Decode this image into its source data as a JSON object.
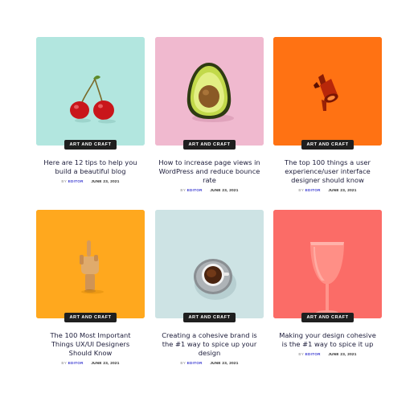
{
  "posts": [
    {
      "category": "ART AND CRAFT",
      "title": "Here are 12 tips to help you build a beautiful blog",
      "by": "BY",
      "author": "EDITOR",
      "date": "JUNE 23, 2021",
      "image_bg": "#b2e6df",
      "image_subject": "cherries"
    },
    {
      "category": "ART AND CRAFT",
      "title": "How to increase page views in WordPress and reduce bounce rate",
      "by": "BY",
      "author": "EDITOR",
      "date": "JUNE 23, 2021",
      "image_bg": "#f0b9cf",
      "image_subject": "avocado"
    },
    {
      "category": "ART AND CRAFT",
      "title": "The top 100 things a user experience/user interface designer should know",
      "by": "BY",
      "author": "EDITOR",
      "date": "JUNE 23, 2021",
      "image_bg": "#ff7213",
      "image_subject": "megaphone"
    },
    {
      "category": "ART AND CRAFT",
      "title": "The 100 Most Important Things UX/UI Designers Should Know",
      "by": "BY",
      "author": "EDITOR",
      "date": "JUNE 23, 2021",
      "image_bg": "#ffa81e",
      "image_subject": "wooden-hand"
    },
    {
      "category": "ART AND CRAFT",
      "title": "Creating a cohesive brand is the #1 way to spice up your design",
      "by": "BY",
      "author": "EDITOR",
      "date": "JUNE 23, 2021",
      "image_bg": "#cde3e4",
      "image_subject": "coffee-cup"
    },
    {
      "category": "ART AND CRAFT",
      "title": "Making your design cohesive is the #1 way to spice it up",
      "by": "BY",
      "author": "EDITOR",
      "date": "JUNE 23, 2021",
      "image_bg": "#fb6c67",
      "image_subject": "wine-glass"
    }
  ]
}
